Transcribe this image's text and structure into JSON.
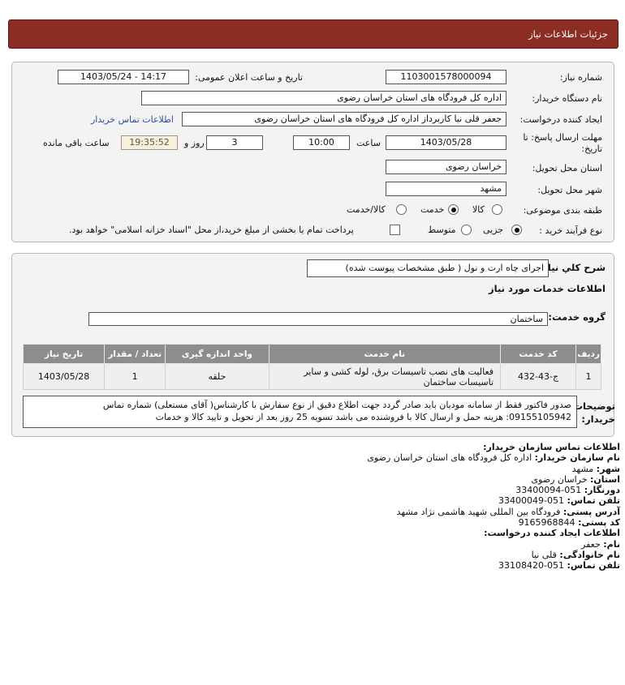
{
  "header": {
    "title": "جزئیات اطلاعات نیاز"
  },
  "form": {
    "need_number_label": "شماره نیاز:",
    "need_number": "1103001578000094",
    "announce_label": "تاریخ و ساعت اعلان عمومی:",
    "announce_value": "1403/05/24 - 14:17",
    "buyer_org_label": "نام دستگاه خریدار:",
    "buyer_org": "اداره کل فرودگاه های استان خراسان رضوی",
    "creator_label": "ایجاد کننده درخواست:",
    "creator": "جعفر قلی نیا کاربرداز اداره کل فرودگاه های استان خراسان رضوی",
    "contact_link": "اطلاعات تماس خریدار",
    "deadline_label_line1": "مهلت ارسال پاسخ: تا",
    "deadline_label_line2": "تاریخ:",
    "deadline_date": "1403/05/28",
    "time_label": "ساعت",
    "deadline_time": "10:00",
    "days_value": "3",
    "days_label": "روز و",
    "remaining_time": "19:35:52",
    "remaining_label": "ساعت باقی مانده",
    "province_label": "استان محل تحویل:",
    "province": "خراسان رضوی",
    "city_label": "شهر محل تحویل:",
    "city": "مشهد",
    "category_label": "طبقه بندی موضوعی:",
    "category_options": [
      "کالا",
      "خدمت",
      "کالا/خدمت"
    ],
    "category_selected": "خدمت",
    "process_label": "نوع فرآیند خرید :",
    "process_options": [
      "جزیی",
      "متوسط"
    ],
    "process_selected": "جزیی",
    "treasury_note": "پرداخت تمام یا بخشی از مبلغ خرید،از محل \"اسناد خزانه اسلامی\" خواهد بود."
  },
  "description": {
    "label": "شرح کلي نياز:",
    "value": "اجرای چاه ارت و نول ( طبق مشخصات پیوست شده)",
    "services_heading": "اطلاعات خدمات مورد نیاز",
    "service_group_label": "گروه خدمت:",
    "service_group": "ساختمان"
  },
  "table": {
    "headers": [
      "ردیف",
      "کد خدمت",
      "نام خدمت",
      "واحد اندازه گیری",
      "تعداد / مقدار",
      "تاریخ نیاز"
    ],
    "rows": [
      [
        "1",
        "ج-43-432",
        "فعالیت های نصب تاسیسات برق، لوله کشی و سایر تاسیسات ساختمان",
        "حلقه",
        "1",
        "1403/05/28"
      ]
    ]
  },
  "notes": {
    "label_line1": "توضیحات",
    "label_line2": "خریدار:",
    "text_line1": "صدور فاکتور فقط از سامانه مودیان باید صادر گردد جهت اطلاع دقیق از نوع سفارش با کارشناس( آقای مستعلی) شماره تماس",
    "text_line2": "09155105942: هزینه حمل و ارسال کالا با فروشنده می باشد تسویه 25 روز بعد از تحویل و تایید کالا و خدمات"
  },
  "contact": {
    "heading": "اطلاعات تماس سازمان خریدار:",
    "org_label": "نام سازمان خریدار:",
    "org": "اداره کل فرودگاه های استان خراسان رضوی",
    "city_label": "شهر:",
    "city": "مشهد",
    "province_label": "استان:",
    "province": "خراسان رضوی",
    "fax_label": "دورنگار:",
    "fax": "051-33400094",
    "phone_label": "تلفن تماس:",
    "phone": "051-33400049",
    "address_label": "آدرس پستی:",
    "address": "فرودگاه بین المللی شهید هاشمی نژاد مشهد",
    "postal_label": "کد پستی:",
    "postal": "9165968844",
    "creator_heading": "اطلاعات ایجاد کننده درخواست:",
    "first_name_label": "نام:",
    "first_name": "جعفر",
    "last_name_label": "نام خانوادگی:",
    "last_name": "قلی نیا",
    "creator_phone_label": "تلفن تماس:",
    "creator_phone": "051-33108420"
  }
}
